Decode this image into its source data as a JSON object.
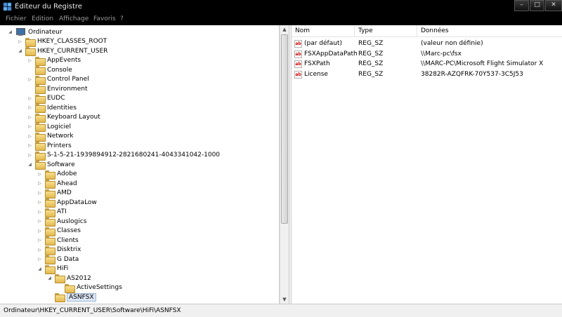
{
  "window": {
    "title": "Éditeur du Registre",
    "buttons": [
      "–",
      "□",
      "✕"
    ]
  },
  "menu": [
    "Fichier",
    "Edition",
    "Affichage",
    "Favoris",
    "?"
  ],
  "tree": [
    {
      "label": "Ordinateur",
      "level": 0,
      "toggle": "expanded",
      "icon": "computer"
    },
    {
      "label": "HKEY_CLASSES_ROOT",
      "level": 1,
      "toggle": "collapsed",
      "icon": "folder"
    },
    {
      "label": "HKEY_CURRENT_USER",
      "level": 1,
      "toggle": "expanded",
      "icon": "folder"
    },
    {
      "label": "AppEvents",
      "level": 2,
      "toggle": "collapsed",
      "icon": "folder"
    },
    {
      "label": "Console",
      "level": 2,
      "toggle": "none",
      "icon": "folder"
    },
    {
      "label": "Control Panel",
      "level": 2,
      "toggle": "collapsed",
      "icon": "folder"
    },
    {
      "label": "Environment",
      "level": 2,
      "toggle": "none",
      "icon": "folder"
    },
    {
      "label": "EUDC",
      "level": 2,
      "toggle": "collapsed",
      "icon": "folder"
    },
    {
      "label": "Identities",
      "level": 2,
      "toggle": "collapsed",
      "icon": "folder"
    },
    {
      "label": "Keyboard Layout",
      "level": 2,
      "toggle": "collapsed",
      "icon": "folder"
    },
    {
      "label": "Logiciel",
      "level": 2,
      "toggle": "collapsed",
      "icon": "folder"
    },
    {
      "label": "Network",
      "level": 2,
      "toggle": "collapsed",
      "icon": "folder"
    },
    {
      "label": "Printers",
      "level": 2,
      "toggle": "collapsed",
      "icon": "folder"
    },
    {
      "label": "S-1-5-21-1939894912-2821680241-4043341042-1000",
      "level": 2,
      "toggle": "collapsed",
      "icon": "folder"
    },
    {
      "label": "Software",
      "level": 2,
      "toggle": "expanded",
      "icon": "folder"
    },
    {
      "label": "Adobe",
      "level": 3,
      "toggle": "collapsed",
      "icon": "folder"
    },
    {
      "label": "Ahead",
      "level": 3,
      "toggle": "collapsed",
      "icon": "folder"
    },
    {
      "label": "AMD",
      "level": 3,
      "toggle": "collapsed",
      "icon": "folder"
    },
    {
      "label": "AppDataLow",
      "level": 3,
      "toggle": "collapsed",
      "icon": "folder"
    },
    {
      "label": "ATI",
      "level": 3,
      "toggle": "collapsed",
      "icon": "folder"
    },
    {
      "label": "Auslogics",
      "level": 3,
      "toggle": "collapsed",
      "icon": "folder"
    },
    {
      "label": "Classes",
      "level": 3,
      "toggle": "collapsed",
      "icon": "folder"
    },
    {
      "label": "Clients",
      "level": 3,
      "toggle": "collapsed",
      "icon": "folder"
    },
    {
      "label": "Disktrix",
      "level": 3,
      "toggle": "collapsed",
      "icon": "folder"
    },
    {
      "label": "G Data",
      "level": 3,
      "toggle": "collapsed",
      "icon": "folder"
    },
    {
      "label": "HiFi",
      "level": 3,
      "toggle": "expanded",
      "icon": "folder"
    },
    {
      "label": "AS2012",
      "level": 4,
      "toggle": "expanded",
      "icon": "folder"
    },
    {
      "label": "ActiveSettings",
      "level": 5,
      "toggle": "none",
      "icon": "folder"
    },
    {
      "label": "ASNFSX",
      "level": 4,
      "toggle": "none",
      "icon": "folder",
      "selected": true
    }
  ],
  "list": {
    "columns": [
      "Nom",
      "Type",
      "Données"
    ],
    "rows": [
      {
        "name": "(par défaut)",
        "type": "REG_SZ",
        "data": "(valeur non définie)"
      },
      {
        "name": "FSXAppDataPath",
        "type": "REG_SZ",
        "data": "\\\\Marc-pc\\fsx"
      },
      {
        "name": "FSXPath",
        "type": "REG_SZ",
        "data": "\\\\MARC-PC\\Microsoft Flight Simulator X"
      },
      {
        "name": "License",
        "type": "REG_SZ",
        "data": "38282R-AZQFRK-70Y537-3C5J53"
      }
    ]
  },
  "status": {
    "path": "Ordinateur\\HKEY_CURRENT_USER\\Software\\HiFi\\ASNFSX"
  }
}
